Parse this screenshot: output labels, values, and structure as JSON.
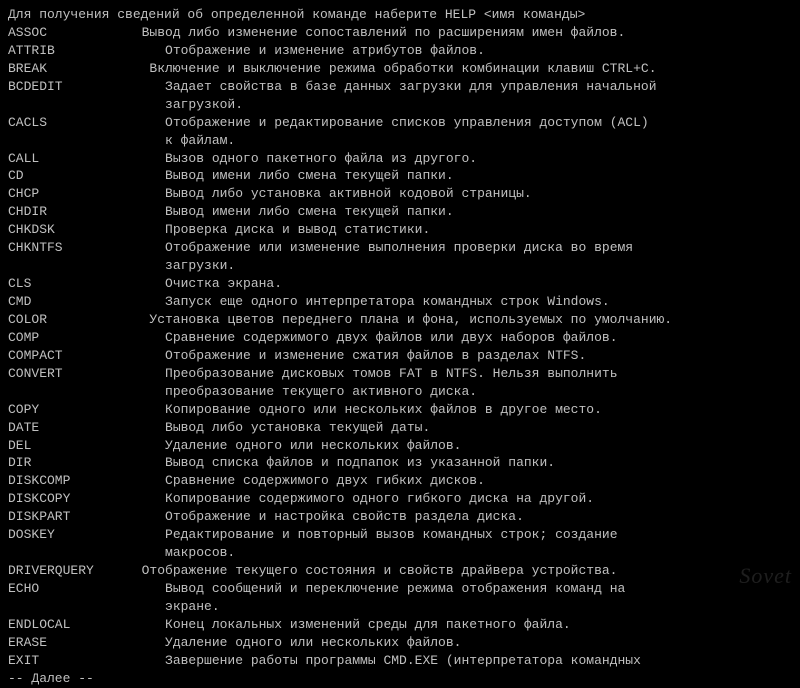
{
  "header": "Для получения сведений об определенной команде наберите HELP <имя команды>",
  "commands": [
    {
      "name": "ASSOC",
      "desc": "  Вывод либо изменение сопоставлений по расширениям имен файлов."
    },
    {
      "name": "ATTRIB",
      "desc": "     Отображение и изменение атрибутов файлов."
    },
    {
      "name": "BREAK",
      "desc": "   Включение и выключение режима обработки комбинации клавиш CTRL+C."
    },
    {
      "name": "BCDEDIT",
      "desc": "     Задает свойства в базе данных загрузки для управления начальной\n     загрузкой."
    },
    {
      "name": "CACLS",
      "desc": "     Отображение и редактирование списков управления доступом (ACL)\n     к файлам."
    },
    {
      "name": "CALL",
      "desc": "     Вызов одного пакетного файла из другого."
    },
    {
      "name": "CD",
      "desc": "     Вывод имени либо смена текущей папки."
    },
    {
      "name": "CHCP",
      "desc": "     Вывод либо установка активной кодовой страницы."
    },
    {
      "name": "CHDIR",
      "desc": "     Вывод имени либо смена текущей папки."
    },
    {
      "name": "CHKDSK",
      "desc": "     Проверка диска и вывод статистики."
    },
    {
      "name": "CHKNTFS",
      "desc": "     Отображение или изменение выполнения проверки диска во время\n     загрузки."
    },
    {
      "name": "CLS",
      "desc": "     Очистка экрана."
    },
    {
      "name": "CMD",
      "desc": "     Запуск еще одного интерпретатора командных строк Windows."
    },
    {
      "name": "COLOR",
      "desc": "   Установка цветов переднего плана и фона, используемых по умолчанию."
    },
    {
      "name": "COMP",
      "desc": "     Сравнение содержимого двух файлов или двух наборов файлов."
    },
    {
      "name": "COMPACT",
      "desc": "     Отображение и изменение сжатия файлов в разделах NTFS."
    },
    {
      "name": "CONVERT",
      "desc": "     Преобразование дисковых томов FAT в NTFS. Нельзя выполнить\n     преобразование текущего активного диска."
    },
    {
      "name": "COPY",
      "desc": "     Копирование одного или нескольких файлов в другое место."
    },
    {
      "name": "DATE",
      "desc": "     Вывод либо установка текущей даты."
    },
    {
      "name": "DEL",
      "desc": "     Удаление одного или нескольких файлов."
    },
    {
      "name": "DIR",
      "desc": "     Вывод списка файлов и подпапок из указанной папки."
    },
    {
      "name": "DISKCOMP",
      "desc": "     Сравнение содержимого двух гибких дисков."
    },
    {
      "name": "DISKCOPY",
      "desc": "     Копирование содержимого одного гибкого диска на другой."
    },
    {
      "name": "DISKPART",
      "desc": "     Отображение и настройка свойств раздела диска."
    },
    {
      "name": "DOSKEY",
      "desc": "     Редактирование и повторный вызов командных строк; создание\n     макросов."
    },
    {
      "name": "DRIVERQUERY",
      "desc": "  Отображение текущего состояния и свойств драйвера устройства."
    },
    {
      "name": "ECHO",
      "desc": "     Вывод сообщений и переключение режима отображения команд на\n     экране."
    },
    {
      "name": "ENDLOCAL",
      "desc": "     Конец локальных изменений среды для пакетного файла."
    },
    {
      "name": "ERASE",
      "desc": "     Удаление одного или нескольких файлов."
    },
    {
      "name": "EXIT",
      "desc": "     Завершение работы программы CMD.EXE (интерпретатора командных"
    }
  ],
  "more": "-- Далее  --",
  "watermark": "Sovet"
}
